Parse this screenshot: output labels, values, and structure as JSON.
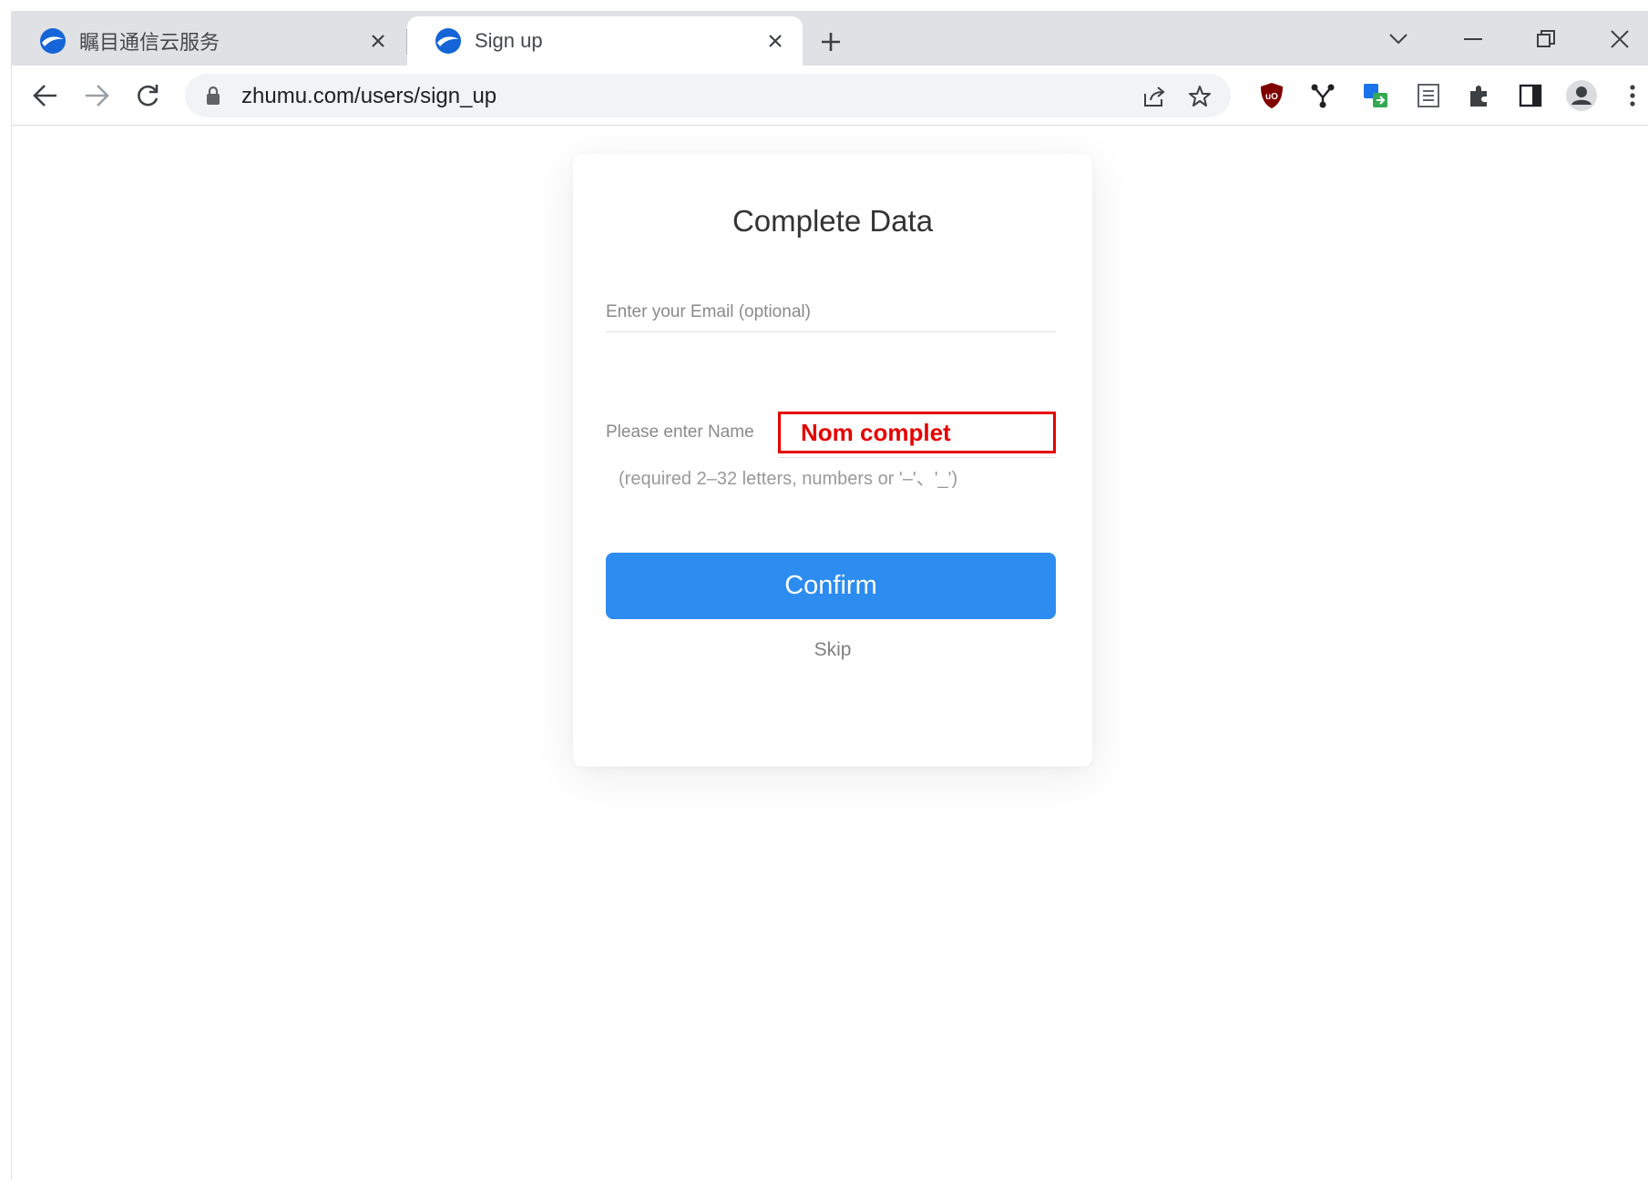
{
  "browser": {
    "tabs": [
      {
        "title": "瞩目通信云服务",
        "active": false
      },
      {
        "title": "Sign up",
        "active": true
      }
    ],
    "url": "zhumu.com/users/sign_up"
  },
  "form": {
    "title": "Complete Data",
    "email_placeholder": "Enter your Email (optional)",
    "email_value": "",
    "name_label": "Please enter Name",
    "name_value": "Nom complet",
    "name_hint": "(required 2–32 letters, numbers or '–'、'_')",
    "confirm_label": "Confirm",
    "skip_label": "Skip"
  },
  "colors": {
    "primary": "#2d8cf0",
    "highlight": "#e60000",
    "favicon": "#1565d8"
  }
}
